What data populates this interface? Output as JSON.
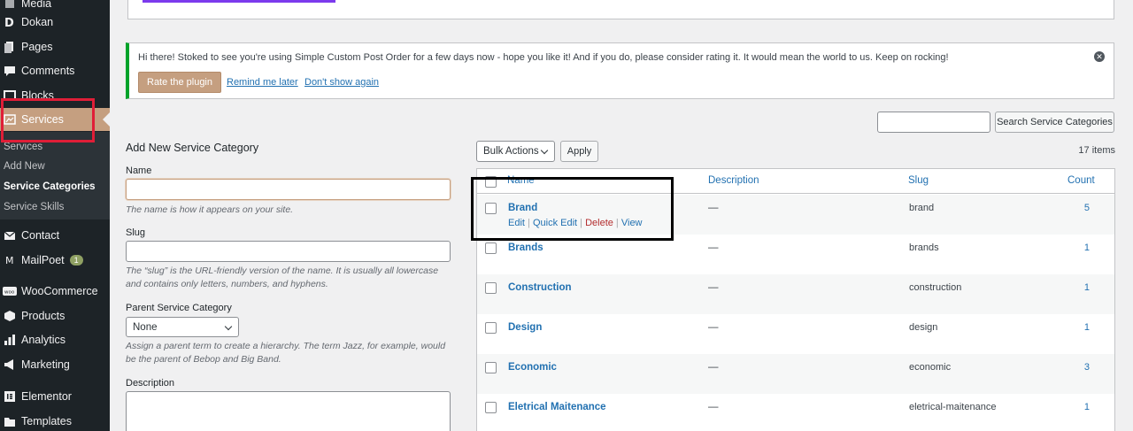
{
  "sidebar": {
    "items": [
      {
        "label": "Media",
        "icon": "media-icon"
      },
      {
        "label": "Dokan",
        "icon": "dokan-icon"
      },
      {
        "label": "Pages",
        "icon": "pages-icon"
      },
      {
        "label": "Comments",
        "icon": "comments-icon"
      },
      {
        "label": "Blocks",
        "icon": "blocks-icon"
      },
      {
        "label": "Services",
        "icon": "services-icon"
      },
      {
        "label": "Contact",
        "icon": "mail-icon"
      },
      {
        "label": "MailPoet",
        "icon": "mailpoet-icon",
        "badge": "1"
      },
      {
        "label": "WooCommerce",
        "icon": "woocommerce-icon"
      },
      {
        "label": "Products",
        "icon": "products-icon"
      },
      {
        "label": "Analytics",
        "icon": "analytics-icon"
      },
      {
        "label": "Marketing",
        "icon": "marketing-icon"
      },
      {
        "label": "Elementor",
        "icon": "elementor-icon"
      },
      {
        "label": "Templates",
        "icon": "templates-icon"
      }
    ],
    "submenu": [
      "Services",
      "Add New",
      "Service Categories",
      "Service Skills"
    ]
  },
  "notice": {
    "text": "Hi there! Stoked to see you're using Simple Custom Post Order for a few days now - hope you like it! And if you do, please consider rating it. It would mean the world to us. Keep on rocking!",
    "rate_button": "Rate the plugin",
    "remind_link": "Remind me later",
    "dismiss_link": "Don't show again"
  },
  "search": {
    "button": "Search Service Categories",
    "value": ""
  },
  "form": {
    "title": "Add New Service Category",
    "name_label": "Name",
    "name_help": "The name is how it appears on your site.",
    "slug_label": "Slug",
    "slug_help": "The “slug” is the URL-friendly version of the name. It is usually all lowercase and contains only letters, numbers, and hyphens.",
    "parent_label": "Parent Service Category",
    "parent_value": "None",
    "parent_help": "Assign a parent term to create a hierarchy. The term Jazz, for example, would be the parent of Bebop and Big Band.",
    "description_label": "Description"
  },
  "table": {
    "bulk_actions": "Bulk Actions",
    "apply": "Apply",
    "items_count": "17 items",
    "headers": {
      "name": "Name",
      "description": "Description",
      "slug": "Slug",
      "count": "Count"
    },
    "row_actions": {
      "edit": "Edit",
      "quick_edit": "Quick Edit",
      "delete": "Delete",
      "view": "View"
    },
    "rows": [
      {
        "name": "Brand",
        "description": "—",
        "slug": "brand",
        "count": "5"
      },
      {
        "name": "Brands",
        "description": "—",
        "slug": "brands",
        "count": "1"
      },
      {
        "name": "Construction",
        "description": "—",
        "slug": "construction",
        "count": "1"
      },
      {
        "name": "Design",
        "description": "—",
        "slug": "design",
        "count": "1"
      },
      {
        "name": "Economic",
        "description": "—",
        "slug": "economic",
        "count": "3"
      },
      {
        "name": "Eletrical Maitenance",
        "description": "—",
        "slug": "eletrical-maitenance",
        "count": "1"
      }
    ]
  },
  "colors": {
    "accent": "#c59f80",
    "link": "#2271b1",
    "sidebar": "#1d2327",
    "notice_border": "#00a32a",
    "delete": "#b32d2e"
  }
}
